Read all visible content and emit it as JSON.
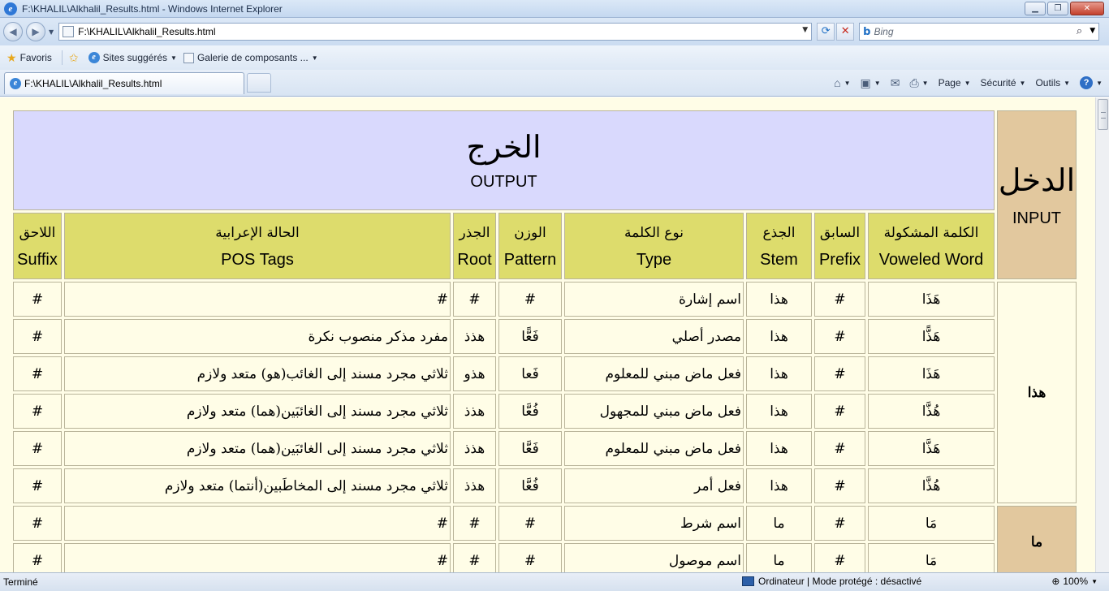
{
  "window": {
    "title": "F:\\KHALIL\\Alkhalil_Results.html - Windows Internet Explorer",
    "minimize": "▁",
    "maximize": "❐",
    "close": "✕"
  },
  "address": {
    "url": "F:\\KHALIL\\Alkhalil_Results.html",
    "search_placeholder": "Bing"
  },
  "favorites": {
    "favoris_label": "Favoris",
    "items": [
      "Sites suggérés",
      "Galerie de composants ..."
    ]
  },
  "tab": {
    "label": "F:\\KHALIL\\Alkhalil_Results.html"
  },
  "commands": {
    "page": "Page",
    "security": "Sécurité",
    "tools": "Outils"
  },
  "table": {
    "input_ar": "الدخل",
    "input_en": "INPUT",
    "output_ar": "الخرج",
    "output_en": "OUTPUT",
    "headers": [
      {
        "ar": "الكلمة المشكولة",
        "en": "Voweled Word"
      },
      {
        "ar": "السابق",
        "en": "Prefix"
      },
      {
        "ar": "الجذع",
        "en": "Stem"
      },
      {
        "ar": "نوع الكلمة",
        "en": "Type"
      },
      {
        "ar": "الوزن",
        "en": "Pattern"
      },
      {
        "ar": "الجذر",
        "en": "Root"
      },
      {
        "ar": "الحالة الإعرابية",
        "en": "POS Tags"
      },
      {
        "ar": "اللاحق",
        "en": "Suffix"
      }
    ],
    "groups": [
      {
        "word": "هذا",
        "rows": [
          {
            "voweled": "هَذَا",
            "prefix": "#",
            "stem": "هذا",
            "type": "اسم إشارة",
            "pattern": "#",
            "root": "#",
            "pos": "#",
            "suffix": "#"
          },
          {
            "voweled": "هَذًّا",
            "prefix": "#",
            "stem": "هذا",
            "type": "مصدر أصلي",
            "pattern": "فَعًّا",
            "root": "هذذ",
            "pos": "مفرد مذكر منصوب نكرة",
            "suffix": "#"
          },
          {
            "voweled": "هَذَا",
            "prefix": "#",
            "stem": "هذا",
            "type": "فعل ماض مبني للمعلوم",
            "pattern": "فَعا",
            "root": "هذو",
            "pos": "ثلاثي مجرد مسند إلى الغائب(هو) متعد ولازم",
            "suffix": "#"
          },
          {
            "voweled": "هُذَّا",
            "prefix": "#",
            "stem": "هذا",
            "type": "فعل ماض مبني للمجهول",
            "pattern": "فُعَّا",
            "root": "هذذ",
            "pos": "ثلاثي مجرد مسند إلى الغائبَين(هما) متعد ولازم",
            "suffix": "#"
          },
          {
            "voweled": "هَذَّا",
            "prefix": "#",
            "stem": "هذا",
            "type": "فعل ماض مبني للمعلوم",
            "pattern": "فَعَّا",
            "root": "هذذ",
            "pos": "ثلاثي مجرد مسند إلى الغائبَين(هما) متعد ولازم",
            "suffix": "#"
          },
          {
            "voweled": "هُذَّا",
            "prefix": "#",
            "stem": "هذا",
            "type": "فعل أمر",
            "pattern": "فُعَّا",
            "root": "هذذ",
            "pos": "ثلاثي مجرد مسند إلى المخاطَبين(أنتما) متعد ولازم",
            "suffix": "#"
          }
        ]
      },
      {
        "word": "ما",
        "rows": [
          {
            "voweled": "مَا",
            "prefix": "#",
            "stem": "ما",
            "type": "اسم شرط",
            "pattern": "#",
            "root": "#",
            "pos": "#",
            "suffix": "#"
          },
          {
            "voweled": "مَا",
            "prefix": "#",
            "stem": "ما",
            "type": "اسم موصول",
            "pattern": "#",
            "root": "#",
            "pos": "#",
            "suffix": "#"
          }
        ]
      }
    ]
  },
  "status": {
    "left": "Terminé",
    "zone": "Ordinateur | Mode protégé : désactivé",
    "zoom": "100%"
  }
}
